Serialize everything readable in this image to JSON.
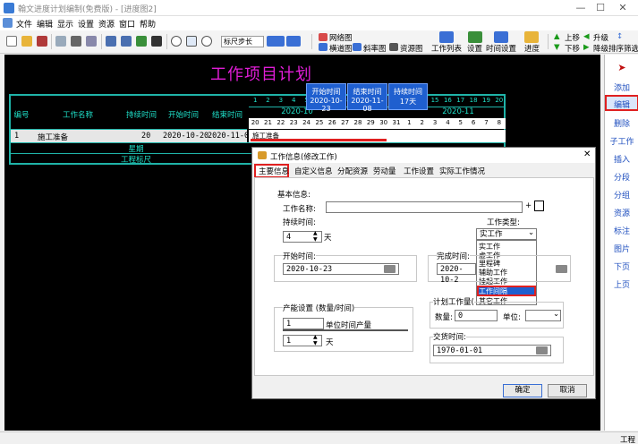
{
  "window": {
    "title": "翰文进度计划编制(免费版) - [进度图2]",
    "min": "—",
    "max": "☐",
    "close": "✕"
  },
  "menu": [
    "文件",
    "编辑",
    "显示",
    "设置",
    "资源",
    "窗口",
    "帮助"
  ],
  "toolbar": {
    "scale_select": "标尺步长",
    "network_chart": "网络图",
    "gantt_chart": "横道图",
    "diagonal_chart": "斜率图",
    "resource_chart": "资源图",
    "task_list": "工作列表",
    "settings": "设置",
    "time_settings": "时间设置",
    "progress": "进度",
    "move_up": "上移",
    "upgrade": "升级",
    "move_down": "下移",
    "downgrade": "降级",
    "sort_filter": "排序筛选"
  },
  "plan": {
    "title": "工作项目计划",
    "columns": [
      "编号",
      "工作名称",
      "持续时间",
      "开始时间",
      "结束时间"
    ],
    "rows": [
      {
        "id": "1",
        "name": "施工准备",
        "duration": "20",
        "start": "2020-10-20",
        "end": "2020-11-08"
      }
    ],
    "footer_1": "星期",
    "footer_2": "工程标尺",
    "month_label_1": "2020-10",
    "month_label_2": "2020-11",
    "days_top": [
      "1",
      "2",
      "3",
      "4",
      "5",
      "6",
      "7",
      "8",
      "9",
      "10",
      "11",
      "12",
      "13",
      "14",
      "15",
      "16",
      "17",
      "18",
      "19",
      "20"
    ],
    "days_bottom": [
      "20",
      "21",
      "22",
      "23",
      "24",
      "25",
      "26",
      "27",
      "28",
      "29",
      "30",
      "31",
      "1",
      "2",
      "3",
      "4",
      "5",
      "6",
      "7",
      "8"
    ],
    "bar_label": "施工准备"
  },
  "popup": {
    "start_label": "开始时间",
    "start_value": "2020-10-23",
    "end_label": "结束时间",
    "end_value": "2020-11-08",
    "duration_label": "持续时间",
    "duration_value": "17天"
  },
  "right_panel": [
    "添加",
    "编辑",
    "删除",
    "子工作",
    "插入",
    "分段",
    "分组",
    "资源",
    "标注",
    "图片",
    "下页",
    "上页"
  ],
  "dialog": {
    "title": "工作信息(修改工作)",
    "tabs": [
      "主要信息",
      "自定义信息",
      "分配资源",
      "劳动量",
      "工作设置",
      "实际工作情况"
    ],
    "basic_info": "基本信息:",
    "task_name_label": "工作名称:",
    "task_name_value": "",
    "plus": "+",
    "duration_label": "持续时间:",
    "duration_value": "4",
    "day_unit": "天",
    "task_type_label": "工作类型:",
    "task_type_value": "实工作",
    "task_type_options": [
      "实工作",
      "虚工作",
      "里程碑",
      "辅助工作",
      "挂起工作",
      "工作间隔",
      "其它工作"
    ],
    "start_label": "开始时间:",
    "start_value": "2020-10-23",
    "finish_label": "完成时间:",
    "finish_value": "2020-10-2",
    "capacity_label": "产能设置 (数量/时间)",
    "capacity_value": "1",
    "capacity_unit": "单位时间产量",
    "capacity_days": "1",
    "plan_qty_label": "计划工作量(",
    "qty_label": "数量:",
    "qty_value": "0",
    "unit_label": "单位:",
    "delivery_label": "交货时间:",
    "delivery_value": "1970-01-01",
    "ok": "确定",
    "cancel": "取消"
  },
  "status": {
    "right": "工程"
  },
  "colors": {
    "accent": "#e01dd6",
    "teal": "#1fe0c9",
    "highlight": "#e02020",
    "link": "#1f4fbf"
  }
}
